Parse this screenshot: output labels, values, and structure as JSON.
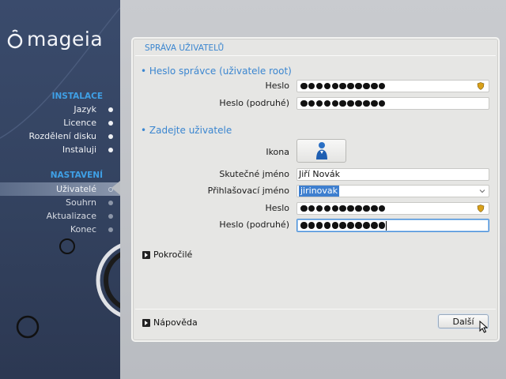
{
  "sidebar": {
    "logo_text": "mageia",
    "sections": [
      {
        "title": "INSTALACE",
        "items": [
          {
            "label": "Jazyk",
            "state": "done"
          },
          {
            "label": "Licence",
            "state": "done"
          },
          {
            "label": "Rozdělení disku",
            "state": "done"
          },
          {
            "label": "Instaluji",
            "state": "done"
          }
        ]
      },
      {
        "title": "NASTAVENÍ",
        "items": [
          {
            "label": "Uživatelé",
            "state": "active"
          },
          {
            "label": "Souhrn",
            "state": "pending"
          },
          {
            "label": "Aktualizace",
            "state": "pending"
          },
          {
            "label": "Konec",
            "state": "pending"
          }
        ]
      }
    ]
  },
  "panel": {
    "title": "SPRÁVA UŽIVATELŮ",
    "root_group": {
      "title": "• Heslo správce (uživatele root)",
      "password_label": "Heslo",
      "password_value": "●●●●●●●●●●●",
      "password_repeat_label": "Heslo (podruhé)",
      "password_repeat_value": "●●●●●●●●●●●"
    },
    "user_group": {
      "title": "• Zadejte uživatele",
      "icon_label": "Ikona",
      "real_name_label": "Skutečné jméno",
      "real_name_value": "Jiří Novák",
      "login_label": "Přihlašovací jméno",
      "login_value": "jirinovak",
      "password_label": "Heslo",
      "password_value": "●●●●●●●●●●●",
      "password_repeat_label": "Heslo (podruhé)",
      "password_repeat_value": "●●●●●●●●●●●"
    },
    "advanced_label": "Pokročilé",
    "help_label": "Nápověda",
    "next_label": "Další"
  },
  "colors": {
    "accent": "#3b86d0",
    "sidebar_heading": "#3fa0e6",
    "sidebar_bg": "#36465f"
  },
  "icons": [
    "shield-icon",
    "user-avatar-icon",
    "chevron-down-icon",
    "expand-triangle-icon",
    "mouse-cursor-icon"
  ]
}
